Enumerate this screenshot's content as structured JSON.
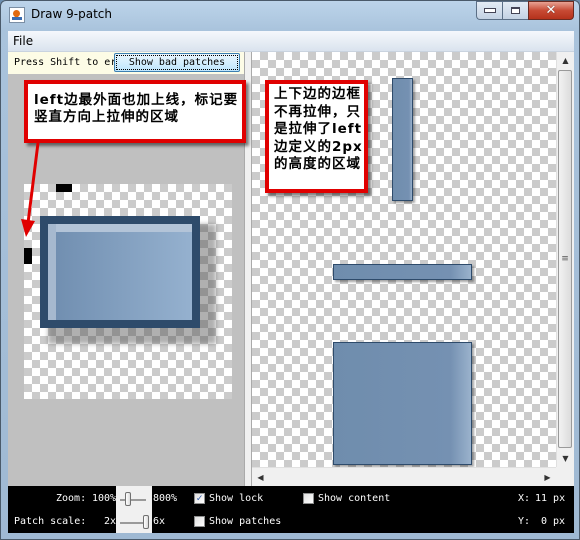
{
  "window": {
    "title": "Draw 9-patch",
    "icon": "java-icon",
    "controls": {
      "minimize": "minimize",
      "maximize": "maximize",
      "close": "✕"
    }
  },
  "menu": {
    "items": [
      {
        "label": "File"
      }
    ]
  },
  "hint": {
    "text": "Press Shift to erase pixels",
    "bad_patches_button": "Show bad patches"
  },
  "annotations": {
    "left_note": "left边最外面也加上线，标记要竖直方向上拉伸的区域",
    "right_note": "上下边的边框不再拉伸，只是拉伸了left边定义的2px的高度的区域"
  },
  "status": {
    "zoom_label": "Zoom:",
    "zoom_min": "100%",
    "zoom_max": "800%",
    "zoom_value_fraction": 0.05,
    "patch_scale_label": "Patch scale:",
    "patch_scale_min": "2x",
    "patch_scale_max": "6x",
    "patch_scale_value_fraction": 1.0,
    "show_lock": {
      "label": "Show lock",
      "checked": true
    },
    "show_patches": {
      "label": "Show patches",
      "checked": false
    },
    "show_content": {
      "label": "Show content",
      "checked": false
    },
    "x_label": "X:",
    "x_value": "11 px",
    "y_label": "Y:",
    "y_value": "0 px"
  },
  "colors": {
    "annotation_border": "#e00000",
    "patch_fill": "#2e4b6b",
    "status_bg": "#000000",
    "hint_bg": "#fdfce6"
  }
}
